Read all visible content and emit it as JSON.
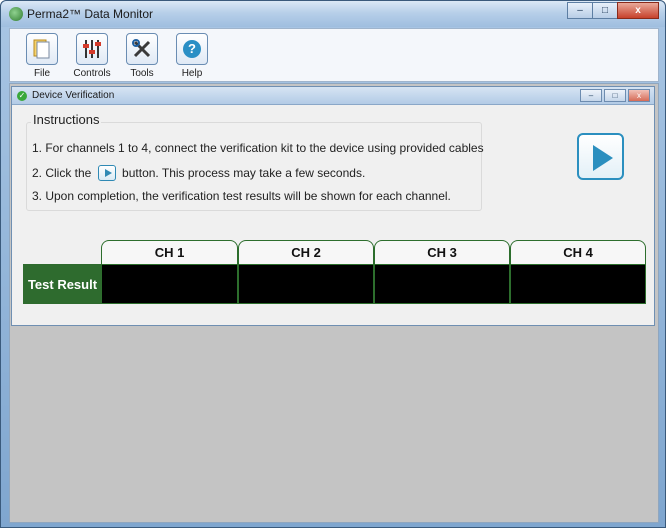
{
  "window": {
    "title": "Perma2™ Data Monitor",
    "controls": {
      "minimize": "–",
      "maximize": "□",
      "close": "x"
    }
  },
  "toolbar": {
    "items": [
      {
        "label": "File",
        "icon": "file-icon"
      },
      {
        "label": "Controls",
        "icon": "sliders-icon"
      },
      {
        "label": "Tools",
        "icon": "tools-icon"
      },
      {
        "label": "Help",
        "icon": "help-icon"
      }
    ]
  },
  "child": {
    "title": "Device Verification",
    "controls": {
      "minimize": "–",
      "maximize": "□",
      "close": "x"
    }
  },
  "instructions": {
    "heading": "Instructions",
    "line1": "1. For channels 1 to 4, connect the verification kit to the device using provided cables",
    "line2_pre": "2. Click the",
    "line2_post": "button. This process may take a few seconds.",
    "line3": "3. Upon completion, the verification test results will be shown for each channel."
  },
  "results": {
    "row_label": "Test Result",
    "channels": [
      "CH 1",
      "CH 2",
      "CH 3",
      "CH 4"
    ],
    "values": [
      "",
      "",
      "",
      ""
    ]
  },
  "colors": {
    "accent_green": "#2e6b2e",
    "play_blue": "#2b8fbf",
    "workspace_grey": "#c4c4c4"
  }
}
